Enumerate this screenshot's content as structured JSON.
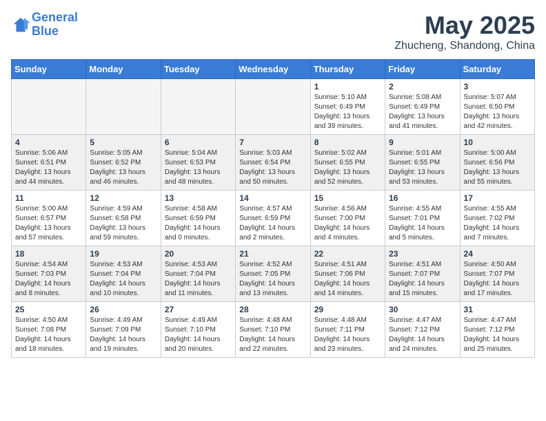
{
  "header": {
    "logo_line1": "General",
    "logo_line2": "Blue",
    "month_year": "May 2025",
    "location": "Zhucheng, Shandong, China"
  },
  "days_of_week": [
    "Sunday",
    "Monday",
    "Tuesday",
    "Wednesday",
    "Thursday",
    "Friday",
    "Saturday"
  ],
  "weeks": [
    [
      {
        "day": "",
        "info": ""
      },
      {
        "day": "",
        "info": ""
      },
      {
        "day": "",
        "info": ""
      },
      {
        "day": "",
        "info": ""
      },
      {
        "day": "1",
        "info": "Sunrise: 5:10 AM\nSunset: 6:49 PM\nDaylight: 13 hours\nand 39 minutes."
      },
      {
        "day": "2",
        "info": "Sunrise: 5:08 AM\nSunset: 6:49 PM\nDaylight: 13 hours\nand 41 minutes."
      },
      {
        "day": "3",
        "info": "Sunrise: 5:07 AM\nSunset: 6:50 PM\nDaylight: 13 hours\nand 42 minutes."
      }
    ],
    [
      {
        "day": "4",
        "info": "Sunrise: 5:06 AM\nSunset: 6:51 PM\nDaylight: 13 hours\nand 44 minutes."
      },
      {
        "day": "5",
        "info": "Sunrise: 5:05 AM\nSunset: 6:52 PM\nDaylight: 13 hours\nand 46 minutes."
      },
      {
        "day": "6",
        "info": "Sunrise: 5:04 AM\nSunset: 6:53 PM\nDaylight: 13 hours\nand 48 minutes."
      },
      {
        "day": "7",
        "info": "Sunrise: 5:03 AM\nSunset: 6:54 PM\nDaylight: 13 hours\nand 50 minutes."
      },
      {
        "day": "8",
        "info": "Sunrise: 5:02 AM\nSunset: 6:55 PM\nDaylight: 13 hours\nand 52 minutes."
      },
      {
        "day": "9",
        "info": "Sunrise: 5:01 AM\nSunset: 6:55 PM\nDaylight: 13 hours\nand 53 minutes."
      },
      {
        "day": "10",
        "info": "Sunrise: 5:00 AM\nSunset: 6:56 PM\nDaylight: 13 hours\nand 55 minutes."
      }
    ],
    [
      {
        "day": "11",
        "info": "Sunrise: 5:00 AM\nSunset: 6:57 PM\nDaylight: 13 hours\nand 57 minutes."
      },
      {
        "day": "12",
        "info": "Sunrise: 4:59 AM\nSunset: 6:58 PM\nDaylight: 13 hours\nand 59 minutes."
      },
      {
        "day": "13",
        "info": "Sunrise: 4:58 AM\nSunset: 6:59 PM\nDaylight: 14 hours\nand 0 minutes."
      },
      {
        "day": "14",
        "info": "Sunrise: 4:57 AM\nSunset: 6:59 PM\nDaylight: 14 hours\nand 2 minutes."
      },
      {
        "day": "15",
        "info": "Sunrise: 4:56 AM\nSunset: 7:00 PM\nDaylight: 14 hours\nand 4 minutes."
      },
      {
        "day": "16",
        "info": "Sunrise: 4:55 AM\nSunset: 7:01 PM\nDaylight: 14 hours\nand 5 minutes."
      },
      {
        "day": "17",
        "info": "Sunrise: 4:55 AM\nSunset: 7:02 PM\nDaylight: 14 hours\nand 7 minutes."
      }
    ],
    [
      {
        "day": "18",
        "info": "Sunrise: 4:54 AM\nSunset: 7:03 PM\nDaylight: 14 hours\nand 8 minutes."
      },
      {
        "day": "19",
        "info": "Sunrise: 4:53 AM\nSunset: 7:04 PM\nDaylight: 14 hours\nand 10 minutes."
      },
      {
        "day": "20",
        "info": "Sunrise: 4:53 AM\nSunset: 7:04 PM\nDaylight: 14 hours\nand 11 minutes."
      },
      {
        "day": "21",
        "info": "Sunrise: 4:52 AM\nSunset: 7:05 PM\nDaylight: 14 hours\nand 13 minutes."
      },
      {
        "day": "22",
        "info": "Sunrise: 4:51 AM\nSunset: 7:06 PM\nDaylight: 14 hours\nand 14 minutes."
      },
      {
        "day": "23",
        "info": "Sunrise: 4:51 AM\nSunset: 7:07 PM\nDaylight: 14 hours\nand 15 minutes."
      },
      {
        "day": "24",
        "info": "Sunrise: 4:50 AM\nSunset: 7:07 PM\nDaylight: 14 hours\nand 17 minutes."
      }
    ],
    [
      {
        "day": "25",
        "info": "Sunrise: 4:50 AM\nSunset: 7:08 PM\nDaylight: 14 hours\nand 18 minutes."
      },
      {
        "day": "26",
        "info": "Sunrise: 4:49 AM\nSunset: 7:09 PM\nDaylight: 14 hours\nand 19 minutes."
      },
      {
        "day": "27",
        "info": "Sunrise: 4:49 AM\nSunset: 7:10 PM\nDaylight: 14 hours\nand 20 minutes."
      },
      {
        "day": "28",
        "info": "Sunrise: 4:48 AM\nSunset: 7:10 PM\nDaylight: 14 hours\nand 22 minutes."
      },
      {
        "day": "29",
        "info": "Sunrise: 4:48 AM\nSunset: 7:11 PM\nDaylight: 14 hours\nand 23 minutes."
      },
      {
        "day": "30",
        "info": "Sunrise: 4:47 AM\nSunset: 7:12 PM\nDaylight: 14 hours\nand 24 minutes."
      },
      {
        "day": "31",
        "info": "Sunrise: 4:47 AM\nSunset: 7:12 PM\nDaylight: 14 hours\nand 25 minutes."
      }
    ]
  ]
}
